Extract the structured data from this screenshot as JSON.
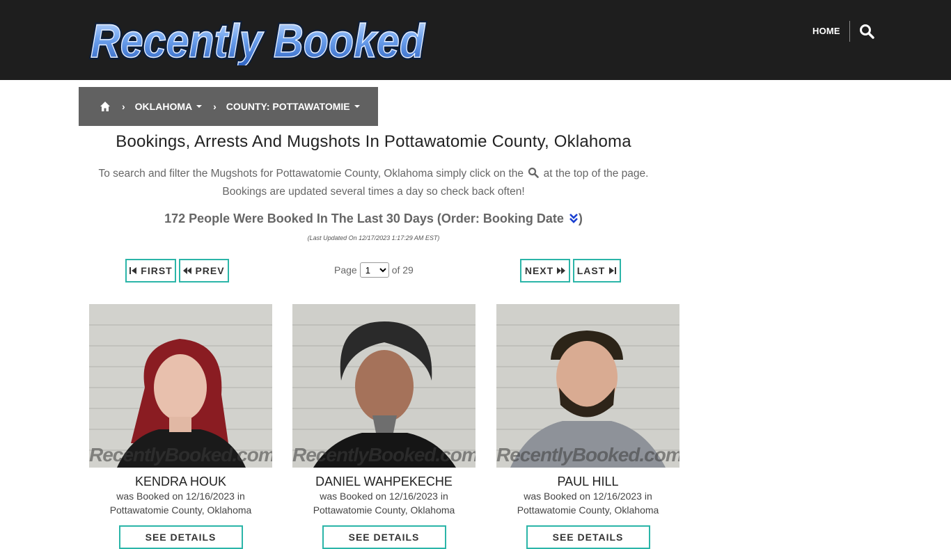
{
  "header": {
    "logo_text": "Recently Booked",
    "nav_home": "HOME",
    "search_icon": "search-icon"
  },
  "breadcrumb": {
    "home_icon": "home-icon",
    "state": "OKLAHOMA",
    "county": "COUNTY: POTTAWATOMIE"
  },
  "main": {
    "title": "Bookings, Arrests And Mugshots In Pottawatomie County, Oklahoma",
    "intro_before": "To search and filter the Mugshots for Pottawatomie County, Oklahoma simply click on the",
    "intro_after": "at the top of the page. Bookings are updated several times a day so check back often!",
    "count_text": "172 People Were Booked In The Last 30 Days (Order: Booking Date",
    "count_close": ")",
    "updated": "(Last Updated On 12/17/2023 1:17:29 AM EST)"
  },
  "pagination": {
    "first": "FIRST",
    "prev": "PREV",
    "next": "NEXT",
    "last": "LAST",
    "page_label": "Page",
    "current_page": "1",
    "of_label": "of 29"
  },
  "bookings": [
    {
      "name": "KENDRA HOUK",
      "booked_line": "was Booked on 12/16/2023 in",
      "location": "Pottawatomie County, Oklahoma",
      "button": "SEE DETAILS"
    },
    {
      "name": "DANIEL WAHPEKECHE",
      "booked_line": "was Booked on 12/16/2023 in",
      "location": "Pottawatomie County, Oklahoma",
      "button": "SEE DETAILS"
    },
    {
      "name": "PAUL HILL",
      "booked_line": "was Booked on 12/16/2023 in",
      "location": "Pottawatomie County, Oklahoma",
      "button": "SEE DETAILS"
    }
  ],
  "watermark": "RecentlyBooked.com",
  "colors": {
    "header_bg": "#1e1e1e",
    "breadcrumb_bg": "#616161",
    "accent": "#2bb5a8",
    "logo_blue": "#3b78d8"
  }
}
